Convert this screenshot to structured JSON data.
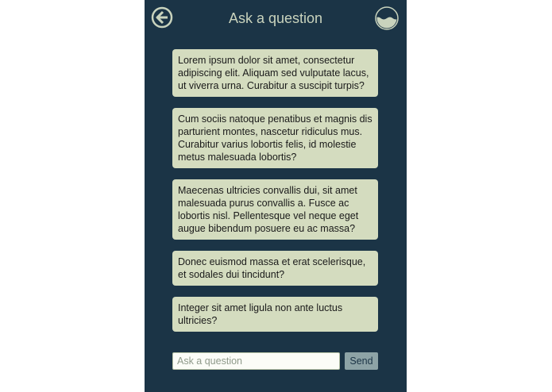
{
  "header": {
    "title": "Ask a question",
    "back_icon": "back-arrow-icon",
    "profile_icon": "water-level-icon"
  },
  "questions": [
    "Lorem ipsum dolor sit amet, consectetur adipiscing elit. Aliquam sed vulputate lacus, ut viverra urna. Curabitur a suscipit turpis?",
    "Cum sociis natoque penatibus et magnis dis parturient montes, nascetur ridiculus mus. Curabitur varius lobortis felis, id molestie metus malesuada lobortis?",
    "Maecenas ultricies convallis dui, sit amet malesuada purus convallis a. Fusce ac lobortis nisl. Pellentesque vel neque eget augue bibendum posuere eu ac massa?",
    "Donec euismod massa et erat scelerisque, et sodales dui tincidunt?",
    "Integer sit amet ligula non ante luctus ultricies?"
  ],
  "composer": {
    "placeholder": "Ask a question",
    "value": "",
    "send_label": "Send"
  },
  "colors": {
    "background": "#1b3446",
    "bubble": "#d4dcbf",
    "accent": "#c9d3bd",
    "send_button": "#8da3a6"
  }
}
